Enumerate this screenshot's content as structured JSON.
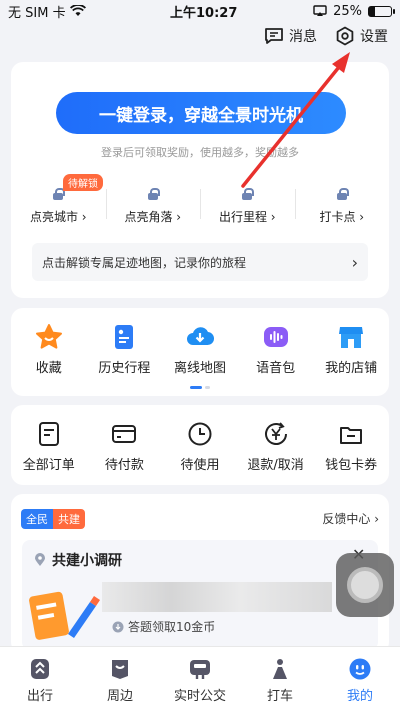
{
  "status_bar": {
    "carrier": "无 SIM 卡",
    "time": "上午10:27",
    "battery": "25%",
    "battery_level": 0.25
  },
  "top_actions": {
    "messages": "消息",
    "settings": "设置"
  },
  "login": {
    "button": "一键登录，穿越全景时光机",
    "hint": "登录后可领取奖励，使用越多，奖励越多",
    "badge": "待解锁",
    "stats": [
      "点亮城市 ›",
      "点亮角落 ›",
      "出行里程 ›",
      "打卡点 ›"
    ],
    "unlock_text": "点击解锁专属足迹地图，记录你的旅程"
  },
  "shortcuts": [
    "收藏",
    "历史行程",
    "离线地图",
    "语音包",
    "我的店铺"
  ],
  "orders": [
    "全部订单",
    "待付款",
    "待使用",
    "退款/取消",
    "钱包卡券"
  ],
  "co_build": {
    "tag1": "全民",
    "tag2": "共建",
    "feedback": "反馈中心 ›",
    "survey_title": "共建小调研",
    "reward": "答题领取10金币"
  },
  "tabbar": [
    "出行",
    "周边",
    "实时公交",
    "打车",
    "我的"
  ],
  "colors": {
    "accent": "#2d7cf6",
    "badge": "#ff6a3d",
    "arrow": "#e8312d"
  }
}
